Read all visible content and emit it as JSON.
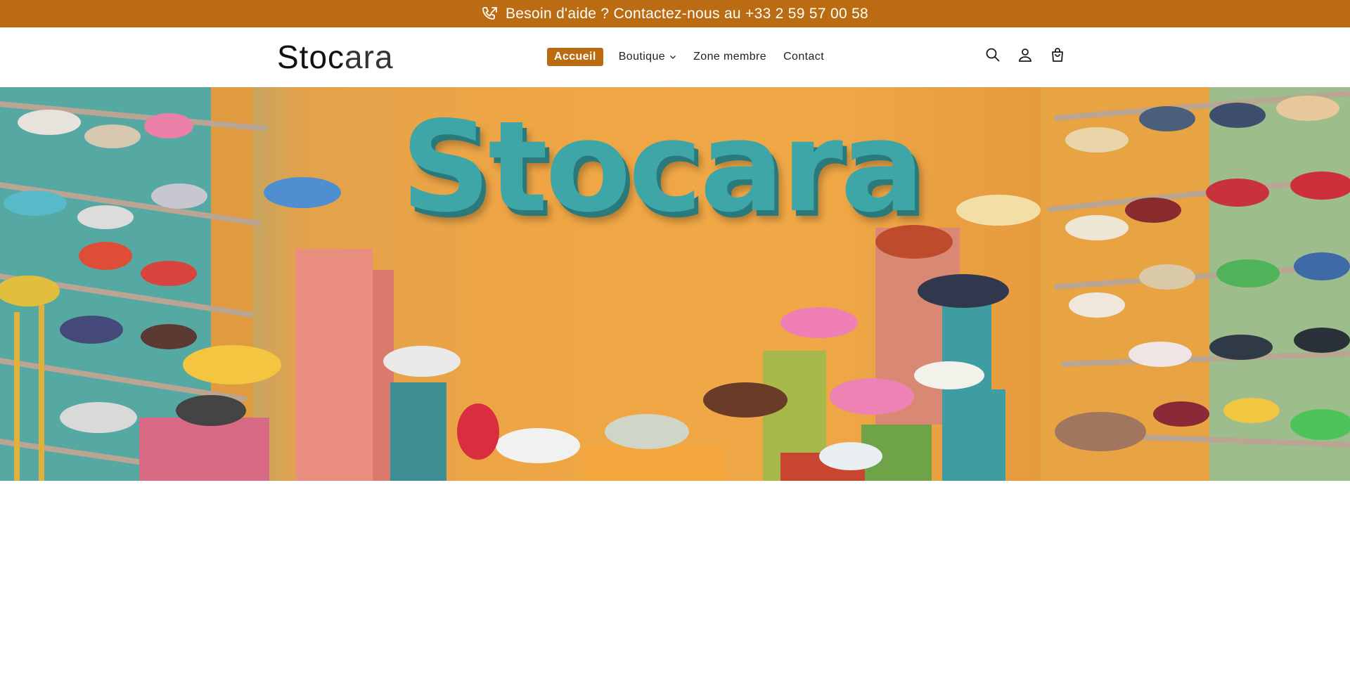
{
  "announcement": {
    "icon": "phone-forward-icon",
    "text": "Besoin d'aide ? Contactez-nous au +33 2 59 57 00 58"
  },
  "header": {
    "logo_part1": "Stoc",
    "logo_part2": "ara",
    "nav": [
      {
        "label": "Accueil",
        "active": true
      },
      {
        "label": "Boutique",
        "has_dropdown": true
      },
      {
        "label": "Zone membre"
      },
      {
        "label": "Contact"
      }
    ],
    "icons": [
      "search-icon",
      "account-icon",
      "cart-icon"
    ]
  },
  "hero": {
    "sign_text": "Stocara"
  },
  "colors": {
    "accent": "#bb6c12",
    "sign": "#3fa6a8"
  }
}
